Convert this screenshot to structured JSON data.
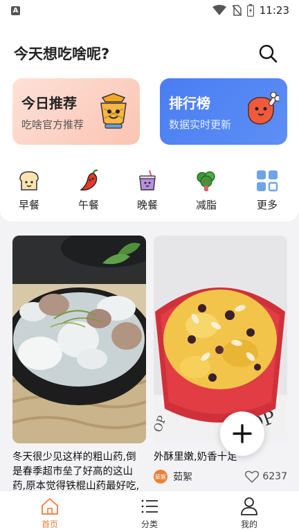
{
  "status_bar": {
    "app_icon": "A",
    "time": "11:23",
    "icons": [
      "wifi-icon",
      "no-sim-icon",
      "battery-charging-icon"
    ]
  },
  "header": {
    "title": "今天想吃啥呢?",
    "search_icon": "search-icon"
  },
  "cards": [
    {
      "title": "今日推荐",
      "subtitle": "吃啥官方推荐",
      "icon": "food-bowl-illustration"
    },
    {
      "title": "排行榜",
      "subtitle": "数据实时更新",
      "icon": "meat-illustration"
    }
  ],
  "categories": [
    {
      "label": "早餐",
      "icon": "bread-icon"
    },
    {
      "label": "午餐",
      "icon": "chili-icon"
    },
    {
      "label": "晚餐",
      "icon": "drink-cup-icon"
    },
    {
      "label": "减脂",
      "icon": "broccoli-icon"
    },
    {
      "label": "更多",
      "icon": "grid-more-icon"
    }
  ],
  "feed": [
    {
      "text": "冬天很少见这样的粗山药,倒是春季超市垒了好高的这山药,原本觉得铁棍山药最好吃,吃过这个才恭之后人",
      "image": "yam-pork-rib-soup"
    },
    {
      "text": "外酥里嫩,奶香十足",
      "image": "bread-pudding",
      "author": "茹絮",
      "avatar_text": "茹絮",
      "likes": "6237"
    }
  ],
  "fab": {
    "icon": "plus-icon"
  },
  "bottom_nav": [
    {
      "label": "首页",
      "icon": "home-icon",
      "active": true
    },
    {
      "label": "分类",
      "icon": "list-icon",
      "active": false
    },
    {
      "label": "我的",
      "icon": "user-icon",
      "active": false
    }
  ],
  "colors": {
    "accent": "#f07a3c",
    "rank_card": "#4a7df2",
    "today_card": "#fbc4b3"
  }
}
